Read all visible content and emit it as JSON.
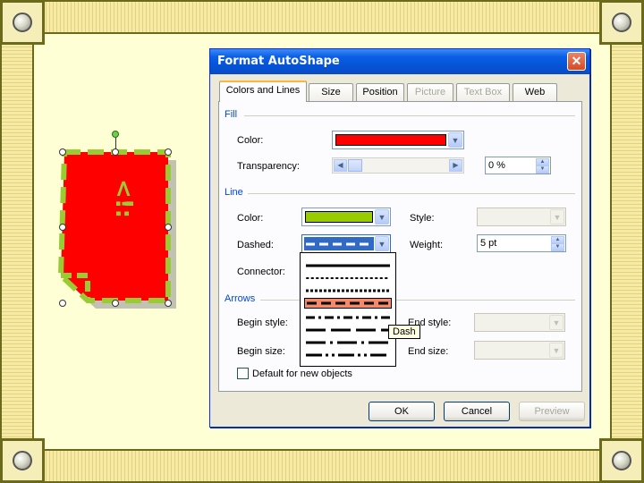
{
  "dialog": {
    "title": "Format AutoShape",
    "tabs": [
      {
        "label": "Colors and Lines",
        "state": "active"
      },
      {
        "label": "Size",
        "state": "normal"
      },
      {
        "label": "Position",
        "state": "normal"
      },
      {
        "label": "Picture",
        "state": "disabled"
      },
      {
        "label": "Text Box",
        "state": "disabled"
      },
      {
        "label": "Web",
        "state": "normal"
      }
    ],
    "fill": {
      "section": "Fill",
      "color_label": "Color:",
      "color_value": "#ff0000",
      "transparency_label": "Transparency:",
      "transparency_value": "0 %"
    },
    "line": {
      "section": "Line",
      "color_label": "Color:",
      "color_value": "#99cc00",
      "style_label": "Style:",
      "dashed_label": "Dashed:",
      "weight_label": "Weight:",
      "weight_value": "5 pt",
      "connector_label": "Connector:"
    },
    "arrows": {
      "section": "Arrows",
      "begin_style_label": "Begin style:",
      "end_style_label": "End style:",
      "begin_size_label": "Begin size:",
      "end_size_label": "End size:"
    },
    "default_checkbox": "Default for new objects",
    "default_checked": false,
    "buttons": {
      "ok": "OK",
      "cancel": "Cancel",
      "preview": "Preview"
    },
    "dash_menu": {
      "options": [
        "solid",
        "round-dot",
        "square-dot",
        "dash",
        "dash-dot",
        "long-dash",
        "long-dash-dot",
        "long-dash-dot-dot"
      ],
      "selected": "dash",
      "tooltip": "Dash"
    }
  },
  "colors": {
    "shape_fill": "#ff0000",
    "shape_outline": "#99cc33",
    "frame": "#6b6a1a",
    "selected_item": "#f58a6a"
  }
}
